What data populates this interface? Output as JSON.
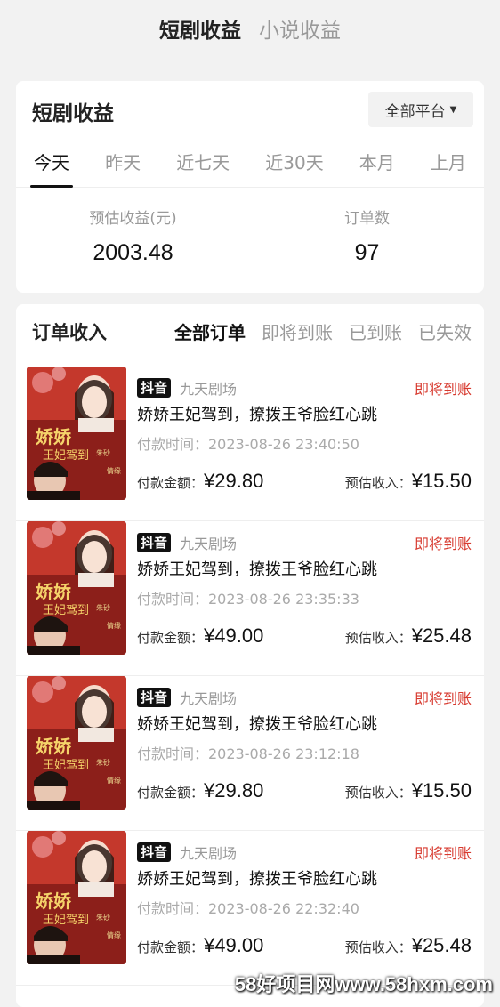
{
  "top_tabs": [
    {
      "label": "短剧收益",
      "active": true
    },
    {
      "label": "小说收益",
      "active": false
    }
  ],
  "summary": {
    "title": "短剧收益",
    "platform_select": "全部平台",
    "date_tabs": [
      "今天",
      "昨天",
      "近七天",
      "近30天",
      "本月",
      "上月"
    ],
    "active_date_tab": "今天",
    "stats": [
      {
        "label": "预估收益(元)",
        "value": "2003.48"
      },
      {
        "label": "订单数",
        "value": "97"
      }
    ]
  },
  "orders": {
    "title": "订单收入",
    "filters": [
      "全部订单",
      "即将到账",
      "已到账",
      "已失效"
    ],
    "active_filter": "全部订单",
    "pay_amount_label": "付款金额：",
    "est_income_label": "预估收入：",
    "items": [
      {
        "platform": "抖音",
        "theater": "九天剧场",
        "status": "即将到账",
        "title": "娇娇王妃驾到，撩拨王爷脸红心跳",
        "pay_time": "付款时间：2023-08-26 23:40:50",
        "pay_amount": "¥29.80",
        "est_income": "¥15.50"
      },
      {
        "platform": "抖音",
        "theater": "九天剧场",
        "status": "即将到账",
        "title": "娇娇王妃驾到，撩拨王爷脸红心跳",
        "pay_time": "付款时间：2023-08-26 23:35:33",
        "pay_amount": "¥49.00",
        "est_income": "¥25.48"
      },
      {
        "platform": "抖音",
        "theater": "九天剧场",
        "status": "即将到账",
        "title": "娇娇王妃驾到，撩拨王爷脸红心跳",
        "pay_time": "付款时间：2023-08-26 23:12:18",
        "pay_amount": "¥29.80",
        "est_income": "¥15.50"
      },
      {
        "platform": "抖音",
        "theater": "九天剧场",
        "status": "即将到账",
        "title": "娇娇王妃驾到，撩拨王爷脸红心跳",
        "pay_time": "付款时间：2023-08-26 22:32:40",
        "pay_amount": "¥49.00",
        "est_income": "¥25.48"
      }
    ]
  },
  "watermark": "58好项目网www.58hxm.com",
  "colors": {
    "status": "#d73a2f",
    "poster": "#8c1f1a"
  }
}
